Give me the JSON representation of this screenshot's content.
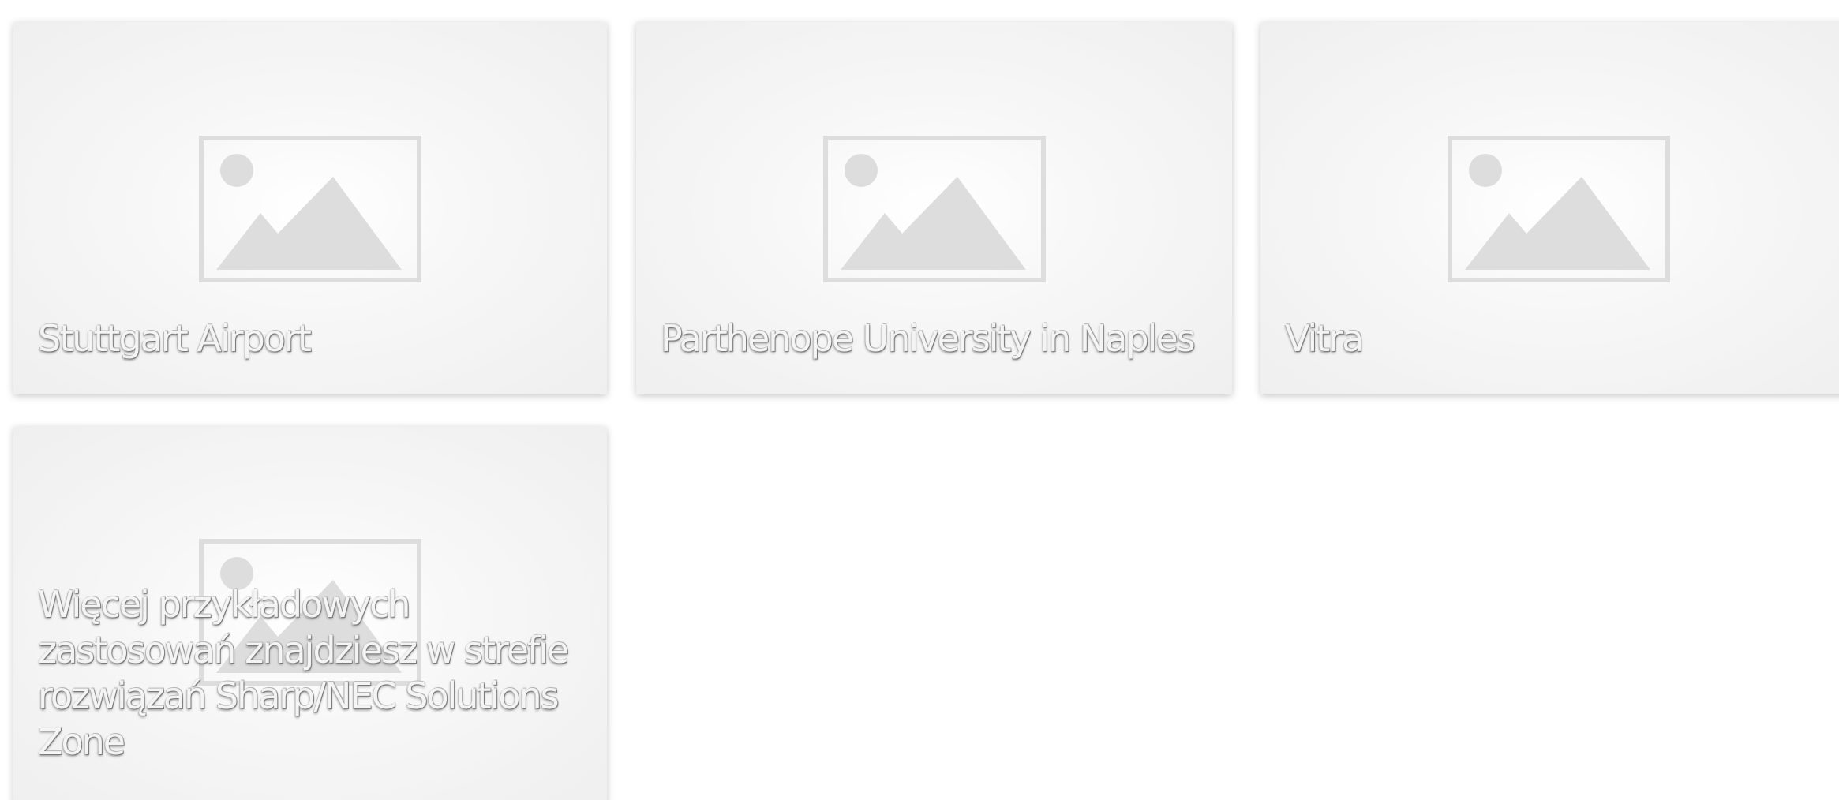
{
  "references": {
    "items": [
      {
        "label": "Stuttgart Airport",
        "image_icon": "image-placeholder-icon"
      },
      {
        "label": "Parthenope University in Naples",
        "image_icon": "image-placeholder-icon"
      },
      {
        "label": "Vitra",
        "image_icon": "image-placeholder-icon"
      },
      {
        "label": "Więcej przykładowych zastosowań znajdziesz w strefie rozwiązań Sharp/NEC Solutions Zone",
        "image_icon": "image-placeholder-icon"
      }
    ]
  },
  "colors": {
    "placeholder_icon": "#dddddd",
    "caption_text": "#f4f4f4",
    "card_background": "#f0f0f0",
    "page_background": "#ffffff"
  }
}
